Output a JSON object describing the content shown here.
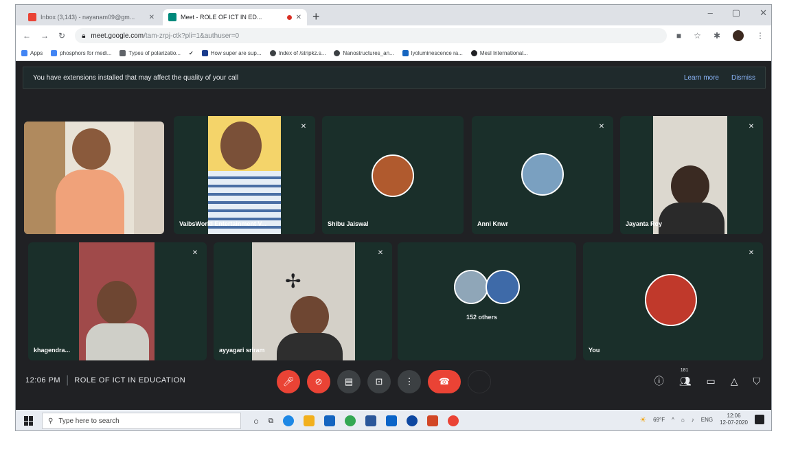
{
  "browser": {
    "tabs": [
      {
        "title": "Inbox (3,143) - nayanam09@gm...",
        "favicon_color": "#ea4335"
      },
      {
        "title": "Meet - ROLE OF ICT IN ED...",
        "favicon_color": "#00897b"
      }
    ],
    "new_tab_symbol": "+",
    "window_controls": [
      "–",
      "▢",
      "✕"
    ],
    "url_host": "meet.google.com",
    "url_rest": "/tam-zrpj-ctk?pli=1&authuser=0",
    "bookmarks": [
      {
        "label": "Apps",
        "color": "#4285f4"
      },
      {
        "label": "phosphors for medi...",
        "color": "#4285f4"
      },
      {
        "label": "Types of polarizatio...",
        "color": "#5f6368"
      },
      {
        "label": "",
        "color": "#202124"
      },
      {
        "label": "How super are sup...",
        "color": "#1a3c8c"
      },
      {
        "label": "Index of /stripkz.s...",
        "color": "#3c4043"
      },
      {
        "label": "Nanostructures_an...",
        "color": "#3c4043"
      },
      {
        "label": "lyoluminescence ra...",
        "color": "#1565c0"
      },
      {
        "label": "Mesl International...",
        "color": "#202124"
      }
    ]
  },
  "meet": {
    "banner": {
      "message": "You have extensions installed that may affect the quality of your call",
      "learn_more": "Learn more",
      "dismiss": "Dismiss"
    },
    "participants": [
      {
        "name": "",
        "kind": "video"
      },
      {
        "name": "VaibsWorld Entertainment V...",
        "kind": "video"
      },
      {
        "name": "Shibu Jaiswal",
        "kind": "avatar"
      },
      {
        "name": "Anni Knwr",
        "kind": "avatar"
      },
      {
        "name": "Jayanta Roy",
        "kind": "video"
      },
      {
        "name": "khagendra...",
        "kind": "video"
      },
      {
        "name": "ayyagari sriram",
        "kind": "video"
      },
      {
        "name": "152 others",
        "kind": "group"
      },
      {
        "name": "You",
        "kind": "avatar"
      }
    ],
    "clock": "12:06 PM",
    "meeting_title": "ROLE OF ICT IN EDUCATION",
    "people_count": "181"
  },
  "taskbar": {
    "search_placeholder": "Type here to search",
    "weather": "69°F",
    "language": "ENG",
    "time": "12:06",
    "date": "12-07-2020"
  },
  "colors": {
    "meet_bg": "#202124",
    "tile_bg": "#1a2f2a",
    "end_call": "#ea4335",
    "link": "#8ab4f8"
  }
}
